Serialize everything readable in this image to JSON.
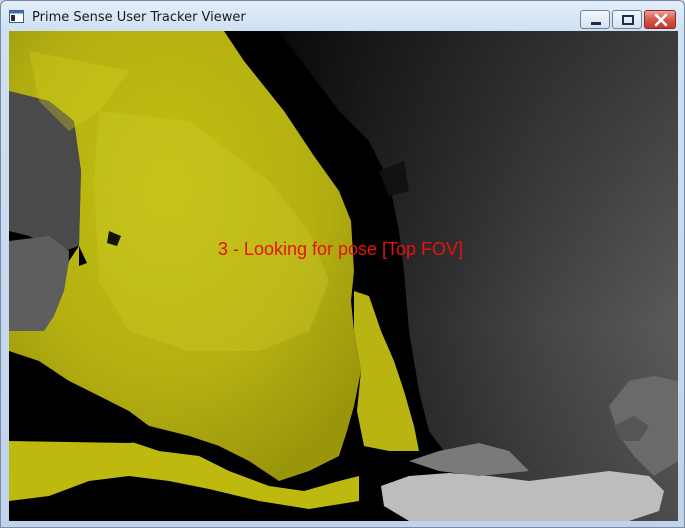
{
  "window": {
    "title": "Prime Sense User Tracker Viewer",
    "icon": "app-window-icon",
    "controls": {
      "minimize": "minimize-icon",
      "maximize": "maximize-icon",
      "close": "close-icon"
    }
  },
  "viewport": {
    "status_text": "3 - Looking for pose [Top FOV]",
    "status_color": "#e8120c",
    "user_color": "#c8c400",
    "background_color": "#000000"
  }
}
